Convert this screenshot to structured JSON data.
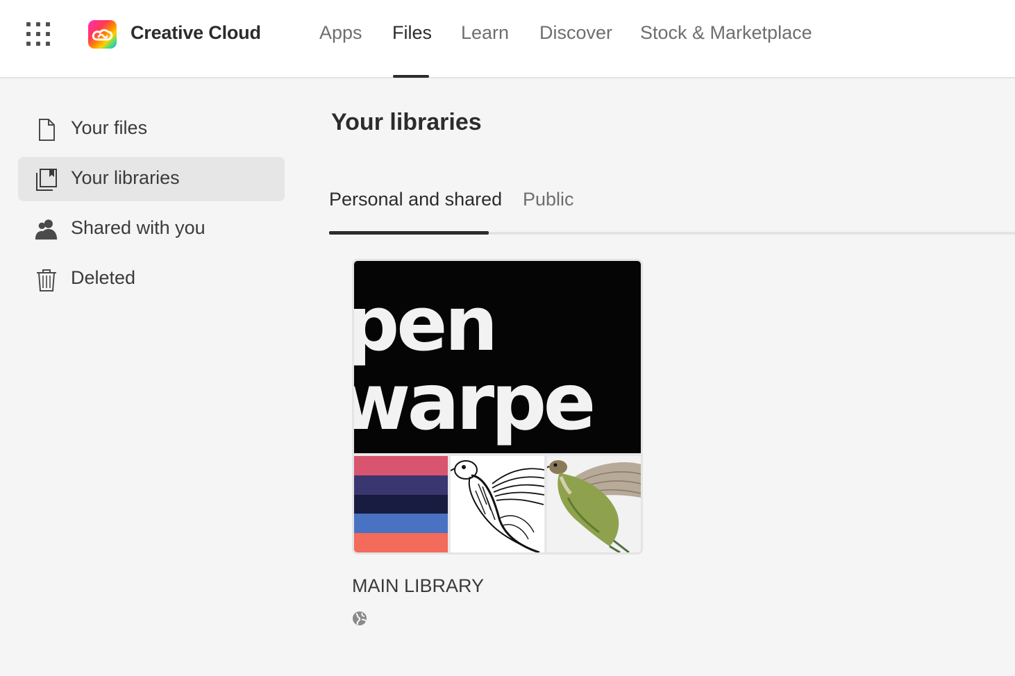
{
  "header": {
    "brand": "Creative Cloud",
    "apps_grid_icon": "app-switcher-grid-icon",
    "nav": [
      {
        "label": "Apps",
        "active": false
      },
      {
        "label": "Files",
        "active": true
      },
      {
        "label": "Learn",
        "active": false
      },
      {
        "label": "Discover",
        "active": false
      },
      {
        "label": "Stock & Marketplace",
        "active": false
      }
    ]
  },
  "sidebar": {
    "items": [
      {
        "label": "Your files",
        "icon": "document-icon",
        "selected": false
      },
      {
        "label": "Your libraries",
        "icon": "library-icon",
        "selected": true
      },
      {
        "label": "Shared with you",
        "icon": "people-icon",
        "selected": false
      },
      {
        "label": "Deleted",
        "icon": "trash-icon",
        "selected": false
      }
    ]
  },
  "main": {
    "title": "Your libraries",
    "tabs": [
      {
        "label": "Personal and shared",
        "active": true
      },
      {
        "label": "Public",
        "active": false
      }
    ],
    "libraries": [
      {
        "name": "MAIN LIBRARY",
        "visibility_icon": "globe-icon",
        "preview_text_line1": "pen",
        "preview_text_line2": "warpe",
        "swatches": [
          "#d9546f",
          "#3a3670",
          "#181c40",
          "#4a72c2",
          "#f26b5b"
        ]
      }
    ]
  },
  "colors": {
    "header_bg": "#ffffff",
    "page_bg": "#f5f5f5",
    "text_primary": "#2c2c2c",
    "text_secondary": "#6e6e6e"
  }
}
